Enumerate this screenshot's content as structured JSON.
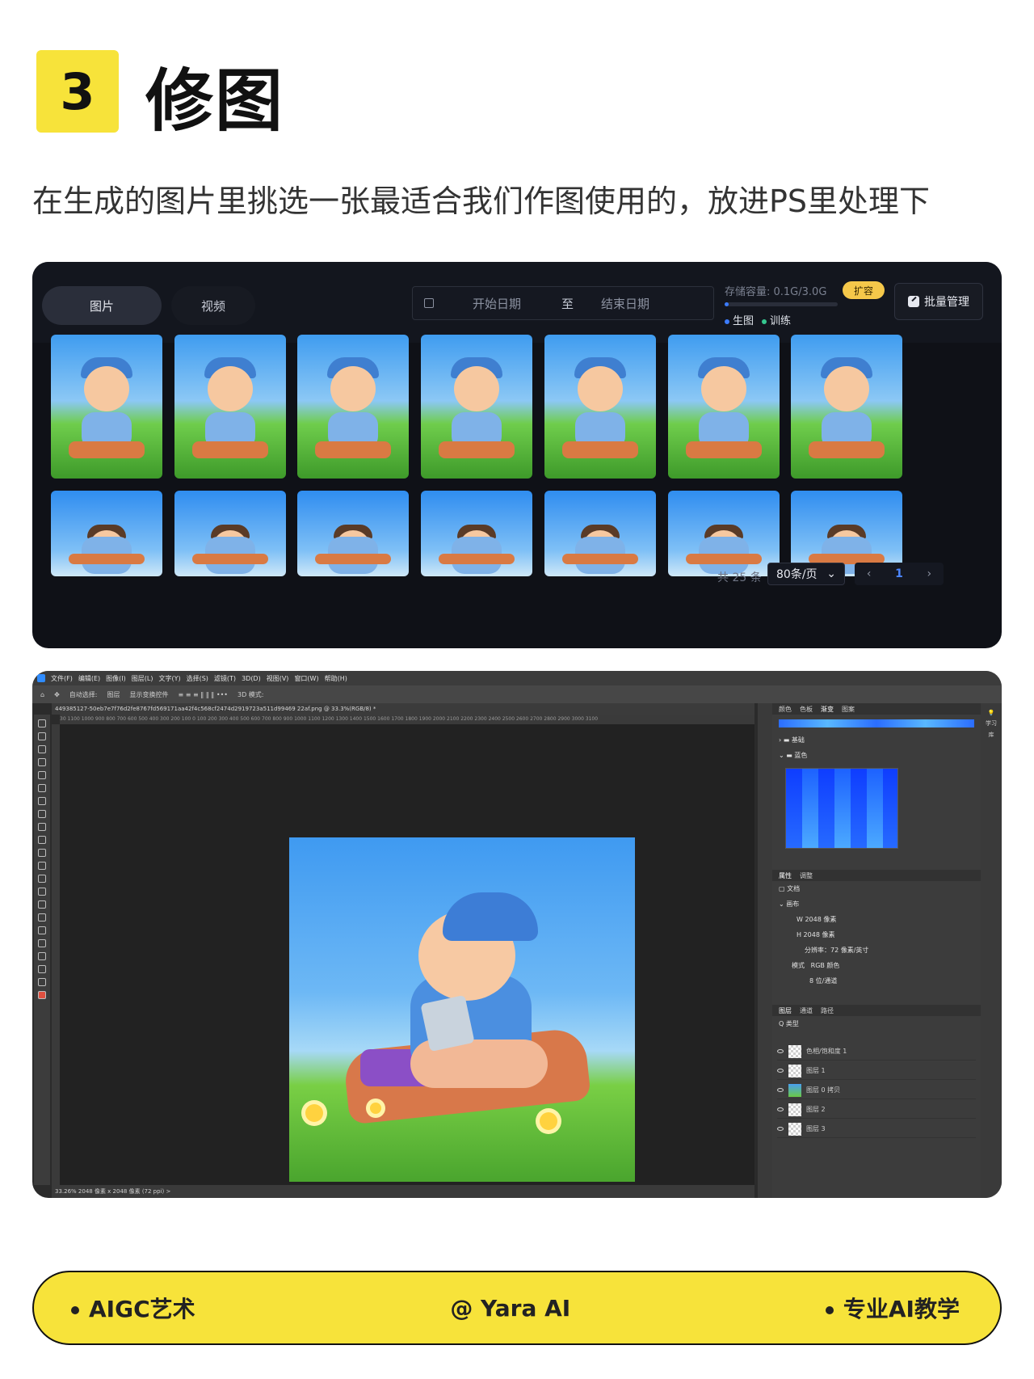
{
  "header": {
    "step_number": "3",
    "title": "修图",
    "subtitle": "在生成的图片里挑选一张最适合我们作图使用的，放进PS里处理下"
  },
  "gallery": {
    "tabs": [
      {
        "label": "图片",
        "active": true
      },
      {
        "label": "视频",
        "active": false
      }
    ],
    "date_range": {
      "start_placeholder": "开始日期",
      "separator": "至",
      "end_placeholder": "结束日期"
    },
    "storage": {
      "label": "存储容量: 0.1G/3.0G",
      "used_fraction": 0.033,
      "expand_label": "扩容"
    },
    "legend": [
      {
        "label": "生图",
        "color": "#3c7cff"
      },
      {
        "label": "训练",
        "color": "#35c78f"
      }
    ],
    "batch_button": "批量管理",
    "thumbnails_row1": 7,
    "thumbnails_row2": 7,
    "total_label": "共 25 条",
    "page_size": "80条/页",
    "current_page": "1",
    "colors": {
      "accent": "#3c7cff",
      "badge": "#f5c84a",
      "panel_bg": "#0f1117"
    }
  },
  "photoshop": {
    "menu": [
      "文件(F)",
      "编辑(E)",
      "图像(I)",
      "图层(L)",
      "文字(Y)",
      "选择(S)",
      "滤镜(T)",
      "3D(D)",
      "视图(V)",
      "窗口(W)",
      "帮助(H)"
    ],
    "options": {
      "auto_select": "自动选择:",
      "layer": "图层",
      "transform": "显示变换控件",
      "mode_3d": "3D 模式:"
    },
    "file_tab": "449385127-50eb7e7f76d2fe8767fd569171aa42f4c568cf2474d2919723a511d99469 22af.png @ 33.3%(RGB/8) *",
    "ruler": "30 1100 1000 900 800 700 600 500 400 300 200 100 0 100 200 300 400 500 600 700 800 900 1000 1100 1200 1300 1400 1500 1600 1700 1800 1900 2000 2100 2200 2300 2400 2500 2600 2700 2800 2900 3000 3100",
    "status": "33.26%    2048 像素 x 2048 像素 (72 ppi)   >",
    "swatch_panel": {
      "tabs": [
        "颜色",
        "色板",
        "渐变",
        "图案"
      ],
      "active": "渐变",
      "groups": [
        "基础",
        "蓝色"
      ]
    },
    "properties_panel": {
      "tabs": [
        "属性",
        "调整"
      ],
      "doc_label": "文档",
      "canvas_label": "画布",
      "width": "W  2048 像素",
      "height": "H  2048 像素",
      "resolution": "分辨率：72 像素/英寸",
      "mode_label": "模式",
      "mode": "RGB 颜色",
      "bit_depth": "8 位/通道"
    },
    "layers_panel": {
      "tabs": [
        "图层",
        "通道",
        "路径"
      ],
      "filter": "Q 类型",
      "layers": [
        {
          "name": "色相/饱和度 1",
          "thumb": "adjust"
        },
        {
          "name": "图层 1",
          "thumb": "empty"
        },
        {
          "name": "图层 0 拷贝",
          "thumb": "image"
        },
        {
          "name": "图层 2",
          "thumb": "empty"
        },
        {
          "name": "图层 3",
          "thumb": "empty"
        }
      ]
    },
    "right_rail": {
      "learn": "学习",
      "library": "库"
    }
  },
  "footer": {
    "left": "AIGC艺术",
    "center": "@ Yara AI",
    "right": "专业AI教学",
    "color": "#f7e33a"
  }
}
